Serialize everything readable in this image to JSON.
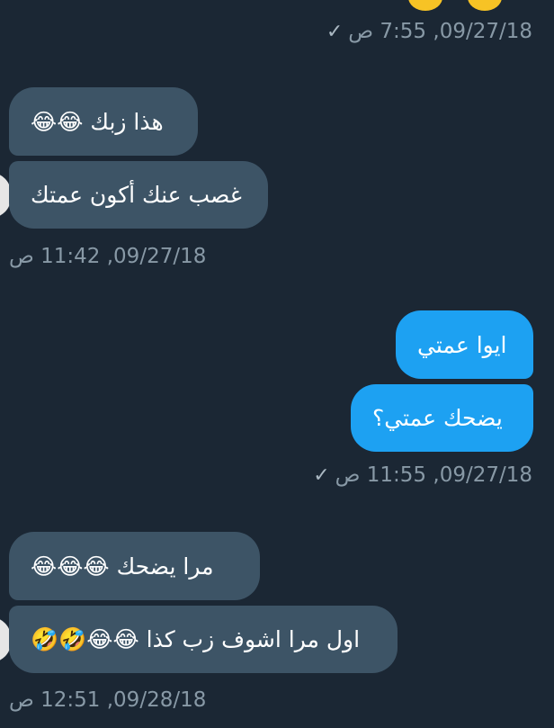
{
  "messages": [
    {
      "id": "ts0",
      "text": "09/27/18, 7:55 ص"
    },
    {
      "id": "m1",
      "text": "هذا زبك 😂😂"
    },
    {
      "id": "m2",
      "text": "غصب عنك أكون عمتك"
    },
    {
      "id": "ts1",
      "text": "09/27/18, 11:42 ص"
    },
    {
      "id": "m3",
      "text": "ايوا عمتي"
    },
    {
      "id": "m4",
      "text": "يضحك عمتي؟"
    },
    {
      "id": "ts2",
      "text": "09/27/18, 11:55 ص"
    },
    {
      "id": "m5",
      "text": "مرا يضحك 😂😂😂"
    },
    {
      "id": "m6",
      "text": "اول مرا اشوف زب كذا 😂😂🤣🤣"
    },
    {
      "id": "ts3",
      "text": "09/28/18, 12:51 ص"
    }
  ],
  "icons": {
    "check": "checkmark-icon"
  },
  "colors": {
    "background": "#1b2734",
    "incoming": "#3d5466",
    "outgoing": "#1da1f2",
    "timestamp": "#8899a6"
  }
}
